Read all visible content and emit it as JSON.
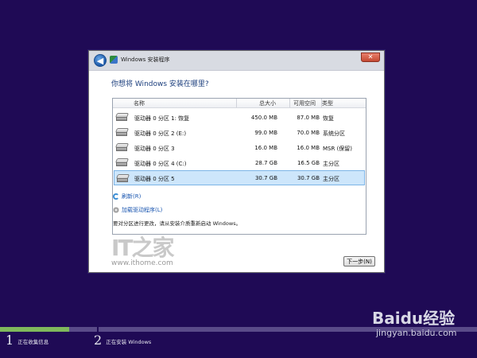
{
  "window": {
    "title": "Windows 安装程序",
    "close_glyph": "✕",
    "back_glyph": "◀"
  },
  "heading": "你想将 Windows 安装在哪里?",
  "table": {
    "columns": [
      "名称",
      "总大小",
      "可用空间",
      "类型"
    ],
    "rows": [
      {
        "name": "驱动器 0 分区 1: 恢复",
        "total": "450.0 MB",
        "free": "87.0 MB",
        "type": "恢复",
        "selected": false
      },
      {
        "name": "驱动器 0 分区 2 (E:)",
        "total": "99.0 MB",
        "free": "70.0 MB",
        "type": "系统分区",
        "selected": false
      },
      {
        "name": "驱动器 0 分区 3",
        "total": "16.0 MB",
        "free": "16.0 MB",
        "type": "MSR (保留)",
        "selected": false
      },
      {
        "name": "驱动器 0 分区 4 (C:)",
        "total": "28.7 GB",
        "free": "16.5 GB",
        "type": "主分区",
        "selected": false
      },
      {
        "name": "驱动器 0 分区 5",
        "total": "30.7 GB",
        "free": "30.7 GB",
        "type": "主分区",
        "selected": true
      }
    ]
  },
  "links": {
    "refresh": "刷新(R)",
    "load_driver": "加载驱动程序(L)"
  },
  "warning": "要对分区进行更改，请从安装介质重新启动 Windows。",
  "buttons": {
    "next": "下一步(N)"
  },
  "watermark": {
    "logo": "IT之家",
    "url": "www.ithome.com"
  },
  "steps": [
    {
      "number": "1",
      "label": "正在收集信息"
    },
    {
      "number": "2",
      "label": "正在安装 Windows"
    }
  ],
  "progress": {
    "fraction": 0.145
  },
  "baidu": {
    "brand": "Baidu经验",
    "url": "jingyan.baidu.com"
  },
  "colors": {
    "background": "#1f0a55",
    "progress_fill": "#7fb85c",
    "selection": "#cde6fb",
    "heading": "#1a3d7c",
    "link": "#1a56b0"
  }
}
